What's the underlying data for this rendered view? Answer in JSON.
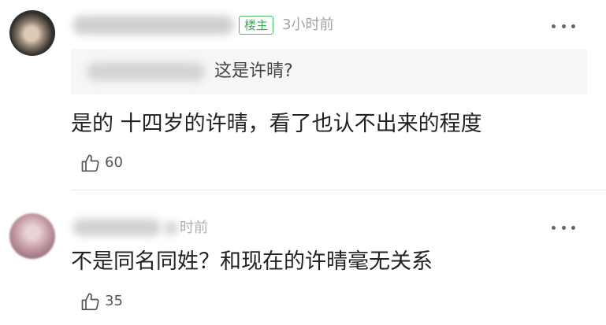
{
  "colors": {
    "accent": "#42bd56",
    "text": "#222222",
    "muted": "#a3a3a3",
    "quote_bg": "#f6f6f6",
    "divider": "#e8e8e8"
  },
  "icons": {
    "more": "more-icon",
    "like": "thumbs-up-icon"
  },
  "comments": [
    {
      "badge": "楼主",
      "time": "3小时前",
      "quote": {
        "text": "这是许晴?"
      },
      "body": "是的 十四岁的许晴，看了也认不出来的程度",
      "likes": "60"
    },
    {
      "time": "时前",
      "body": "不是同名同姓？和现在的许晴毫无关系",
      "likes": "35"
    }
  ]
}
